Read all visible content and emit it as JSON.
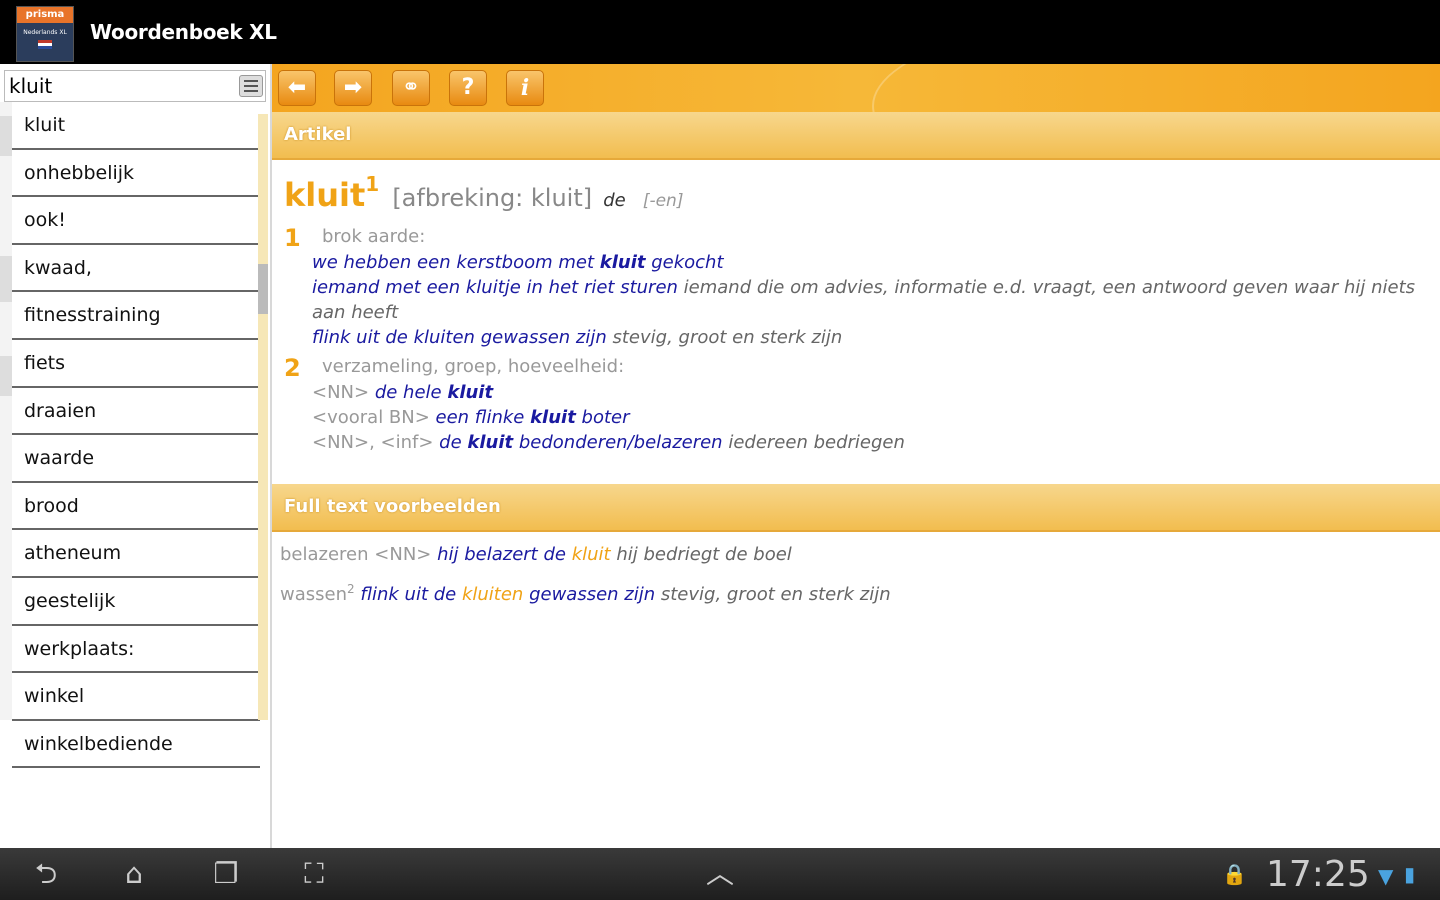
{
  "app": {
    "title": "Woordenboek XL",
    "logo_text": "prisma",
    "logo_sub": "Nederlands XL"
  },
  "search": {
    "value": "kluit",
    "placeholder": ""
  },
  "word_list": [
    "kluit",
    "onhebbelijk",
    "ook!",
    "kwaad,",
    "fitnesstraining",
    "fiets",
    "draaien",
    "waarde",
    "brood",
    "atheneum",
    "geestelijk",
    "werkplaats:",
    "winkel",
    "winkelbediende"
  ],
  "toolbar": {
    "back": "⬅",
    "forward": "➡",
    "link": "⚭",
    "help": "?",
    "info": "i"
  },
  "article": {
    "header": "Artikel",
    "headword": "kluit",
    "headword_sup": "1",
    "hyphenation": "[afbreking: kluit]",
    "gender": "de",
    "plural": "[-en]",
    "senses": [
      {
        "num": "1",
        "definition": "brok aarde:",
        "examples": [
          {
            "a": "we hebben een kerstboom met ",
            "k": "kluit",
            "b": " gekocht",
            "m": "",
            "lbl": ""
          },
          {
            "a": "iemand met een kluitje in het riet sturen",
            "k": "",
            "b": "",
            "m": " iemand die om advies, informatie e.d. vraagt, een antwoord geven waar hij niets aan heeft",
            "lbl": ""
          },
          {
            "a": "flink uit de kluiten gewassen zijn",
            "k": "",
            "b": "",
            "m": " stevig, groot en sterk zijn",
            "lbl": ""
          }
        ]
      },
      {
        "num": "2",
        "definition": "verzameling, groep, hoeveelheid:",
        "examples": [
          {
            "lbl": "<NN> ",
            "a": "de hele ",
            "k": "kluit",
            "b": "",
            "m": ""
          },
          {
            "lbl": "<vooral BN> ",
            "a": "een flinke ",
            "k": "kluit",
            "b": " boter",
            "m": ""
          },
          {
            "lbl": "<NN>, <inf> ",
            "a": "de ",
            "k": "kluit",
            "b": " bedonderen/belazeren",
            "m": " iedereen bedriegen"
          }
        ]
      }
    ]
  },
  "fulltext": {
    "header": "Full text voorbeelden",
    "rows": [
      {
        "src": "belazeren",
        "sup": "",
        "lbl": " <NN> ",
        "a": "hij belazert de ",
        "hl": "kluit",
        "b": "",
        "m": " hij bedriegt de boel"
      },
      {
        "src": "wassen",
        "sup": "2",
        "lbl": " ",
        "a": "flink uit de ",
        "hl": "kluiten",
        "b": " gewassen zijn",
        "m": " stevig, groot en sterk zijn"
      }
    ]
  },
  "status": {
    "time": "17:25"
  }
}
